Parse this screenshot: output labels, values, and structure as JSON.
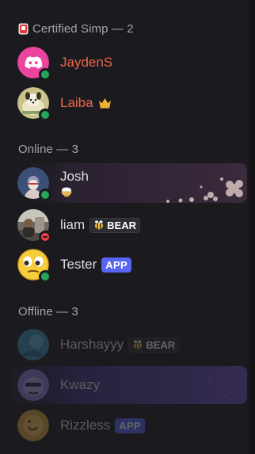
{
  "sections": {
    "certified": {
      "label": "Certified Simp — 2",
      "icon": "role-badge-icon"
    },
    "online": {
      "label": "Online — 3"
    },
    "offline": {
      "label": "Offline — 3"
    }
  },
  "members": {
    "jayden": {
      "name": "JaydenS",
      "status": "online",
      "avatar": "discord-logo-avatar",
      "name_color": "#f0644a"
    },
    "laiba": {
      "name": "Laiba",
      "status": "online",
      "avatar": "cartoon-avatar",
      "name_color": "#f0644a",
      "badge": "crown-icon"
    },
    "josh": {
      "name": "Josh",
      "status": "online",
      "avatar": "anime-avatar",
      "activity_icon": "rice-bowl-icon",
      "banner": "floral-profile-banner"
    },
    "liam": {
      "name": "liam",
      "status": "dnd",
      "avatar": "photo-avatar",
      "tag": {
        "label": "BEAR",
        "icon": "bee-icon"
      }
    },
    "tester": {
      "name": "Tester",
      "status": "online",
      "avatar": "emoji-face-avatar",
      "tag": {
        "label": "APP"
      }
    },
    "harshayyy": {
      "name": "Harshayyy",
      "status": "offline",
      "avatar": "blue-avatar",
      "tag": {
        "label": "BEAR",
        "icon": "bee-icon"
      }
    },
    "kwazy": {
      "name": "Kwazy",
      "status": "offline",
      "avatar": "purple-avatar",
      "banner": "purple-profile-banner"
    },
    "rizzless": {
      "name": "Rizzless",
      "status": "offline",
      "avatar": "yellow-avatar",
      "tag": {
        "label": "APP"
      }
    }
  },
  "colors": {
    "background": "#1b1b1f",
    "header_text": "#a3a4ab",
    "role_name": "#f0644a",
    "online": "#23a55a",
    "dnd": "#f23f43",
    "app_tag": "#5865f2"
  }
}
